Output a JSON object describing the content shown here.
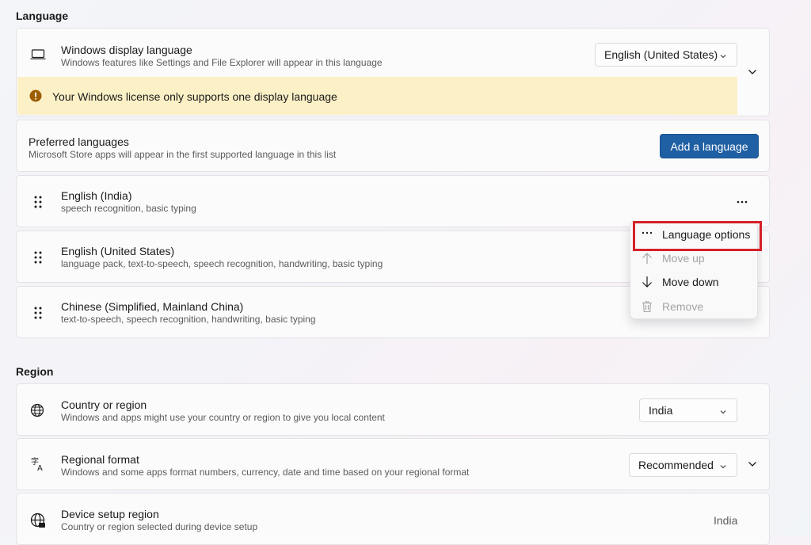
{
  "language_section": {
    "title": "Language",
    "display_language": {
      "title": "Windows display language",
      "subtitle": "Windows features like Settings and File Explorer will appear in this language",
      "value": "English (United States)",
      "warning": "Your Windows license only supports one display language"
    },
    "preferred": {
      "title": "Preferred languages",
      "subtitle": "Microsoft Store apps will appear in the first supported language in this list",
      "add_button": "Add a language"
    },
    "languages": [
      {
        "name": "English (India)",
        "features": "speech recognition, basic typing"
      },
      {
        "name": "English (United States)",
        "features": "language pack, text-to-speech, speech recognition, handwriting, basic typing"
      },
      {
        "name": "Chinese (Simplified, Mainland China)",
        "features": "text-to-speech, speech recognition, handwriting, basic typing"
      }
    ],
    "context_menu": {
      "items": [
        {
          "label": "Language options",
          "icon": "more-icon",
          "enabled": true
        },
        {
          "label": "Move up",
          "icon": "arrow-up-icon",
          "enabled": false
        },
        {
          "label": "Move down",
          "icon": "arrow-down-icon",
          "enabled": true
        },
        {
          "label": "Remove",
          "icon": "trash-icon",
          "enabled": false
        }
      ]
    }
  },
  "region_section": {
    "title": "Region",
    "country": {
      "title": "Country or region",
      "subtitle": "Windows and apps might use your country or region to give you local content",
      "value": "India"
    },
    "format": {
      "title": "Regional format",
      "subtitle": "Windows and some apps format numbers, currency, date and time based on your regional format",
      "value": "Recommended"
    },
    "setup": {
      "title": "Device setup region",
      "subtitle": "Country or region selected during device setup",
      "value": "India"
    }
  },
  "colors": {
    "accent": "#1f5fa3",
    "warning_bg": "#fcf0c6",
    "warning_icon": "#9d5d00",
    "highlight": "#d52027"
  }
}
